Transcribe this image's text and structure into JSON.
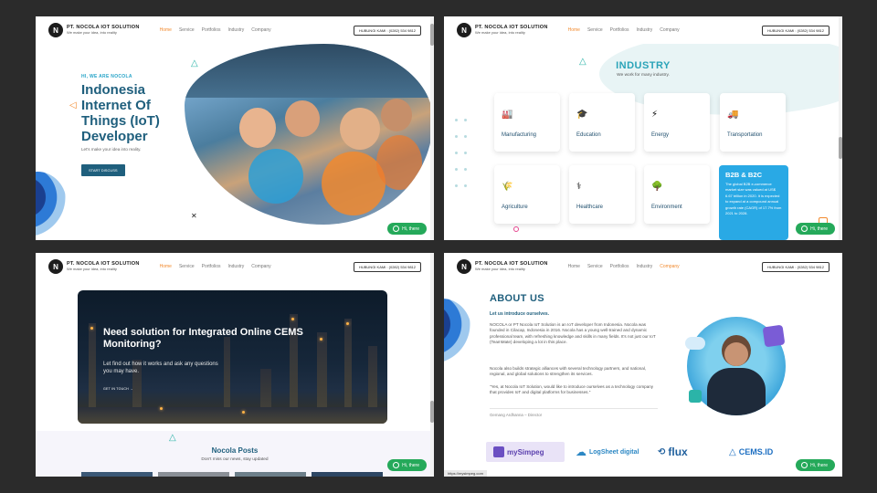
{
  "nav": {
    "logo_name": "PT. NOCOLA IOT SOLUTION",
    "logo_tag": "We make your idea, into reality",
    "items": [
      "Home",
      "Service",
      "Portfolios",
      "Industry",
      "Company"
    ],
    "contact": "HUBUNGI KAMI : (0282) 534 9812"
  },
  "whatsapp": {
    "label": "Hi, there"
  },
  "hero": {
    "eyebrow": "HI, WE ARE NOCOLA",
    "title": "Indonesia Internet Of Things (IoT) Developer",
    "desc": "Let's make your idea into reality.",
    "cta": "START DISCUSS"
  },
  "industry": {
    "title": "INDUSTRY",
    "subtitle": "We work for many industry.",
    "cards": [
      {
        "label": "Manufacturing",
        "icon": "factory-icon"
      },
      {
        "label": "Education",
        "icon": "education-icon"
      },
      {
        "label": "Energy",
        "icon": "energy-icon"
      },
      {
        "label": "Transportation",
        "icon": "transport-icon"
      },
      {
        "label": "Agriculture",
        "icon": "agriculture-icon"
      },
      {
        "label": "Healthcare",
        "icon": "healthcare-icon"
      },
      {
        "label": "Environment",
        "icon": "environment-icon"
      }
    ],
    "b2b_title": "B2B & B2C",
    "b2b_body": "The global B2B e-commerce market size was valued at US$ 6.67 trillion in 2020. It is expected to expand at a compound annual growth rate (CAGR) of 17.7% from 2021 to 2028."
  },
  "cems": {
    "title": "Need solution for Integrated Online CEMS Monitoring?",
    "desc": "Let find out how it works and ask any questions you may have.",
    "link": "GET IN TOUCH →"
  },
  "posts": {
    "title": "Nocola Posts",
    "subtitle": "Don't miss our news, stay updated"
  },
  "about": {
    "title": "ABOUT US",
    "intro": "Let us introduce ourselves.",
    "p1": "NOCOLA or PT Nocola IoT Solution is an IoT developer from Indonesia. Nocola was founded in Cilacap, Indonesia in 2016. Nocola has a young well-trained and dynamic professional team, with refreshing knowledge and skills in many fields. It's not just our IoT (TeamMate) developing a lot in this place.",
    "p2": "Nocola also builds strategic alliances with several technology partners, and national, regional, and global solutions to strengthen its services.",
    "p3": "\"Yes, at Nocola IoT Solution, would like to introduce ourselves as a technology company that provides IoT and digital platforms for businesses.\"",
    "signature": "Gemang Ardhanna – Director",
    "partners": [
      "mySimpeg",
      "LogSheet digital",
      "flux",
      "CEMS.ID"
    ]
  },
  "status_url": "https://mysimpeg.com",
  "colors": {
    "primary": "#1f5f7d",
    "accent": "#2aa3b8",
    "orange": "#f28a2e",
    "whatsapp": "#25a95a"
  }
}
